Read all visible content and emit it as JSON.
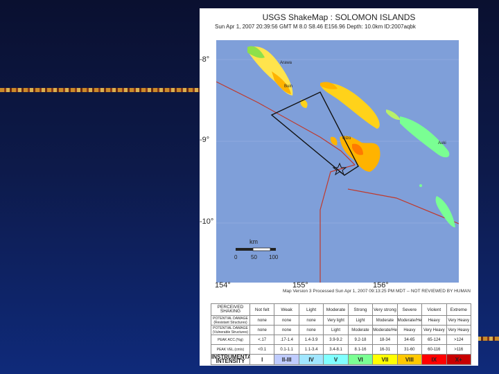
{
  "title": "USGS ShakeMap : SOLOMON ISLANDS",
  "subtitle": "Sun Apr 1, 2007 20:39:56 GMT  M 8.0  S8.46 E156.96  Depth: 10.0km  ID:2007aqbk",
  "lat_labels": [
    "-8°",
    "-9°",
    "-10°"
  ],
  "lon_labels": [
    "154°",
    "155°",
    "156°"
  ],
  "places": [
    "Arawa",
    "Buin",
    "Gizo",
    "Auki"
  ],
  "scale": {
    "unit": "km",
    "ticks": [
      "0",
      "50",
      "100"
    ]
  },
  "version_line": "Map Version 3 Processed Sun Apr 1, 2007 09:13:25 PM MDT -- NOT REVIEWED BY HUMAN",
  "legend": {
    "perceived_label": "PERCEIVED SHAKING",
    "damage_res_label": "POTENTIAL DAMAGE (Resistant Structures)",
    "damage_vul_label": "POTENTIAL DAMAGE (Vulnerable Structures)",
    "pga_label": "PEAK ACC.(%g)",
    "pgv_label": "PEAK VEL.(cm/s)",
    "intensity_label": "INSTRUMENTAL INTENSITY",
    "columns": [
      {
        "shaking": "Not felt",
        "dmg_res": "none",
        "dmg_vul": "none",
        "pga": "<.17",
        "pgv": "<0.1",
        "intensity": "I",
        "color": "#ffffff"
      },
      {
        "shaking": "Weak",
        "dmg_res": "none",
        "dmg_vul": "none",
        "pga": ".17-1.4",
        "pgv": "0.1-1.1",
        "intensity": "II-III",
        "color": "#bfccff"
      },
      {
        "shaking": "Light",
        "dmg_res": "none",
        "dmg_vul": "none",
        "pga": "1.4-3.9",
        "pgv": "1.1-3.4",
        "intensity": "IV",
        "color": "#a0e6ff"
      },
      {
        "shaking": "Moderate",
        "dmg_res": "Very light",
        "dmg_vul": "Light",
        "pga": "3.9-9.2",
        "pgv": "3.4-8.1",
        "intensity": "V",
        "color": "#80ffff"
      },
      {
        "shaking": "Strong",
        "dmg_res": "Light",
        "dmg_vul": "Moderate",
        "pga": "9.2-18",
        "pgv": "8.1-16",
        "intensity": "VI",
        "color": "#7aff93"
      },
      {
        "shaking": "Very strong",
        "dmg_res": "Moderate",
        "dmg_vul": "Moderate/Heavy",
        "pga": "18-34",
        "pgv": "16-31",
        "intensity": "VII",
        "color": "#ffff00"
      },
      {
        "shaking": "Severe",
        "dmg_res": "Moderate/Heavy",
        "dmg_vul": "Heavy",
        "pga": "34-65",
        "pgv": "31-60",
        "intensity": "VIII",
        "color": "#ffc800"
      },
      {
        "shaking": "Violent",
        "dmg_res": "Heavy",
        "dmg_vul": "Very Heavy",
        "pga": "65-124",
        "pgv": "60-116",
        "intensity": "IX",
        "color": "#ff0000"
      },
      {
        "shaking": "Extreme",
        "dmg_res": "Very Heavy",
        "dmg_vul": "Very Heavy",
        "pga": ">124",
        "pgv": ">116",
        "intensity": "X+",
        "color": "#c80000"
      }
    ]
  },
  "colors": {
    "ocean": "#7f9fd9",
    "background_top": "#0a1030",
    "background_bottom": "#0f2a7a",
    "fault_line": "#c0392b",
    "rupture_box": "#111111"
  }
}
